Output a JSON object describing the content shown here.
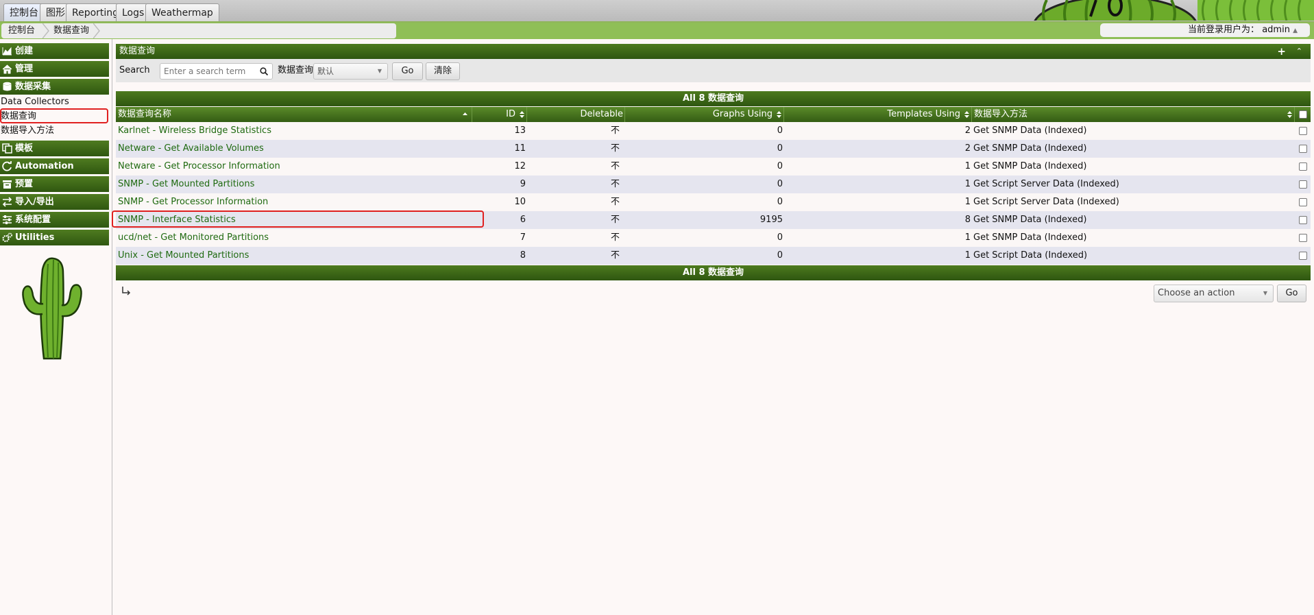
{
  "top_tabs": [
    "控制台",
    "图形",
    "Reporting",
    "Logs",
    "Weathermap"
  ],
  "breadcrumb": [
    "控制台",
    "数据查询"
  ],
  "user": {
    "label": "当前登录用户为：",
    "name": "admin"
  },
  "sidebar": {
    "sections": [
      {
        "label": "创建",
        "icon": "area-chart-icon"
      },
      {
        "label": "管理",
        "icon": "home-icon"
      },
      {
        "label": "数据采集",
        "icon": "database-icon"
      }
    ],
    "sub_items": [
      "Data Collectors",
      "数据查询",
      "数据导入方法"
    ],
    "sections2": [
      {
        "label": "模板",
        "icon": "copy-icon"
      },
      {
        "label": "Automation",
        "icon": "refresh-icon"
      },
      {
        "label": "预置",
        "icon": "archive-icon"
      },
      {
        "label": "导入/导出",
        "icon": "exchange-icon"
      },
      {
        "label": "系统配置",
        "icon": "sliders-icon"
      },
      {
        "label": "Utilities",
        "icon": "cogs-icon"
      }
    ]
  },
  "panel": {
    "title": "数据查询",
    "filter": {
      "search_label": "Search",
      "search_placeholder": "Enter a search term",
      "query_label": "数据查询",
      "query_value": "默认",
      "go_label": "Go",
      "clear_label": "清除"
    },
    "summary": "All 8 数据查询",
    "columns": [
      "数据查询名称",
      "ID",
      "Deletable",
      "Graphs Using",
      "Templates Using",
      "数据导入方法"
    ],
    "rows": [
      {
        "name": "Karlnet - Wireless Bridge Statistics",
        "id": "13",
        "deletable": "不",
        "graphs": "0",
        "templates": "2",
        "method": "Get SNMP Data (Indexed)"
      },
      {
        "name": "Netware - Get Available Volumes",
        "id": "11",
        "deletable": "不",
        "graphs": "0",
        "templates": "2",
        "method": "Get SNMP Data (Indexed)"
      },
      {
        "name": "Netware - Get Processor Information",
        "id": "12",
        "deletable": "不",
        "graphs": "0",
        "templates": "1",
        "method": "Get SNMP Data (Indexed)"
      },
      {
        "name": "SNMP - Get Mounted Partitions",
        "id": "9",
        "deletable": "不",
        "graphs": "0",
        "templates": "1",
        "method": "Get Script Server Data (Indexed)"
      },
      {
        "name": "SNMP - Get Processor Information",
        "id": "10",
        "deletable": "不",
        "graphs": "0",
        "templates": "1",
        "method": "Get Script Server Data (Indexed)"
      },
      {
        "name": "SNMP - Interface Statistics",
        "id": "6",
        "deletable": "不",
        "graphs": "9195",
        "templates": "8",
        "method": "Get SNMP Data (Indexed)"
      },
      {
        "name": "ucd/net - Get Monitored Partitions",
        "id": "7",
        "deletable": "不",
        "graphs": "0",
        "templates": "1",
        "method": "Get SNMP Data (Indexed)"
      },
      {
        "name": "Unix - Get Mounted Partitions",
        "id": "8",
        "deletable": "不",
        "graphs": "0",
        "templates": "1",
        "method": "Get Script Data (Indexed)"
      }
    ],
    "action": {
      "placeholder": "Choose an action",
      "go_label": "Go"
    }
  },
  "colors": {
    "header_green": "#3d6a18",
    "link_green": "#1f6a10",
    "highlight": "#e02020"
  }
}
